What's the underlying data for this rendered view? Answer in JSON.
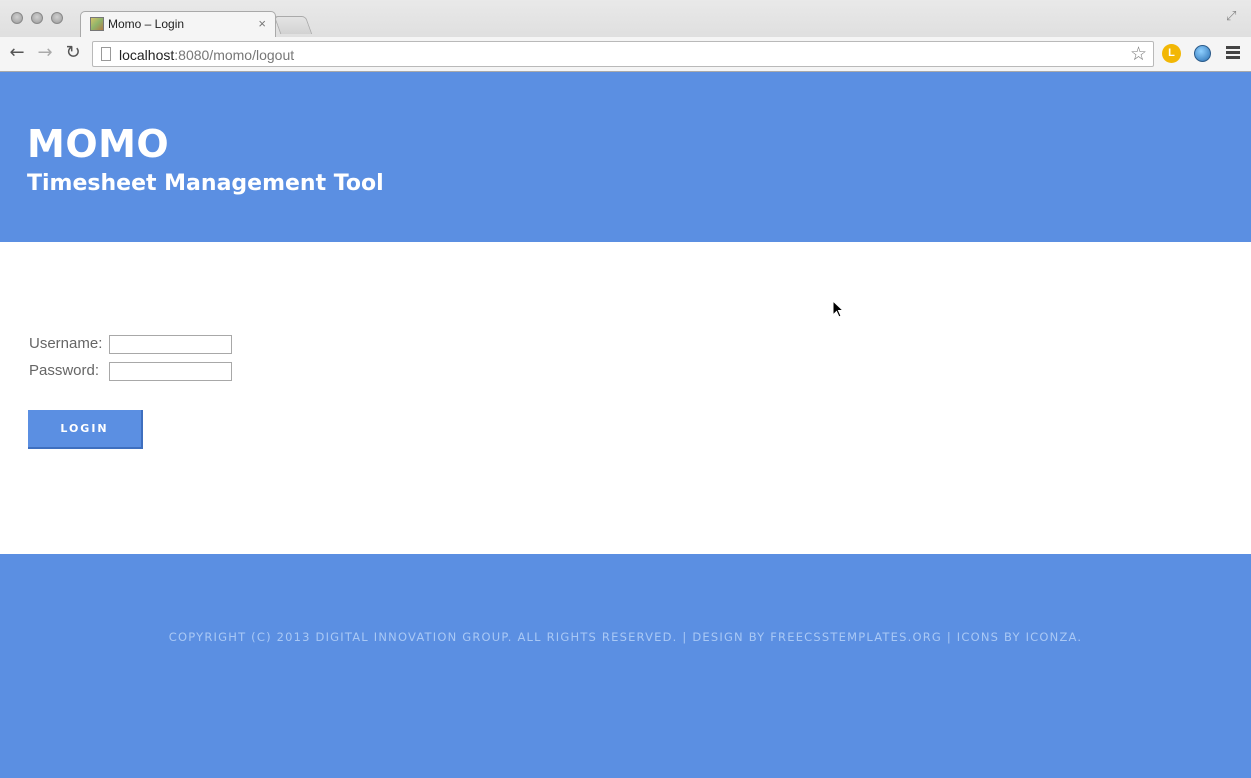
{
  "browser": {
    "tab_title": "Momo – Login",
    "tab_close": "×",
    "url_host": "localhost",
    "url_path": ":8080/momo/logout",
    "back_glyph": "←",
    "forward_glyph": "→",
    "reload_glyph": "↻",
    "star_glyph": "☆",
    "ext_letter": "L",
    "icons": [
      "back-icon",
      "forward-icon",
      "reload-icon",
      "page-icon",
      "bookmark-star-icon",
      "extension-l-icon",
      "globe-icon",
      "menu-icon",
      "fullscreen-icon"
    ]
  },
  "header": {
    "title": "MOMO",
    "subtitle": "Timesheet Management Tool",
    "background": "#5b8fe2"
  },
  "login": {
    "username_label": "Username:",
    "password_label": "Password:",
    "username_value": "",
    "password_value": "",
    "button_label": "LOGIN"
  },
  "footer": {
    "copyright": "COPYRIGHT (C) 2013 DIGITAL INNOVATION GROUP. ALL RIGHTS RESERVED. | DESIGN BY FREECSSTEMPLATES.ORG | ICONS BY ICONZA."
  }
}
